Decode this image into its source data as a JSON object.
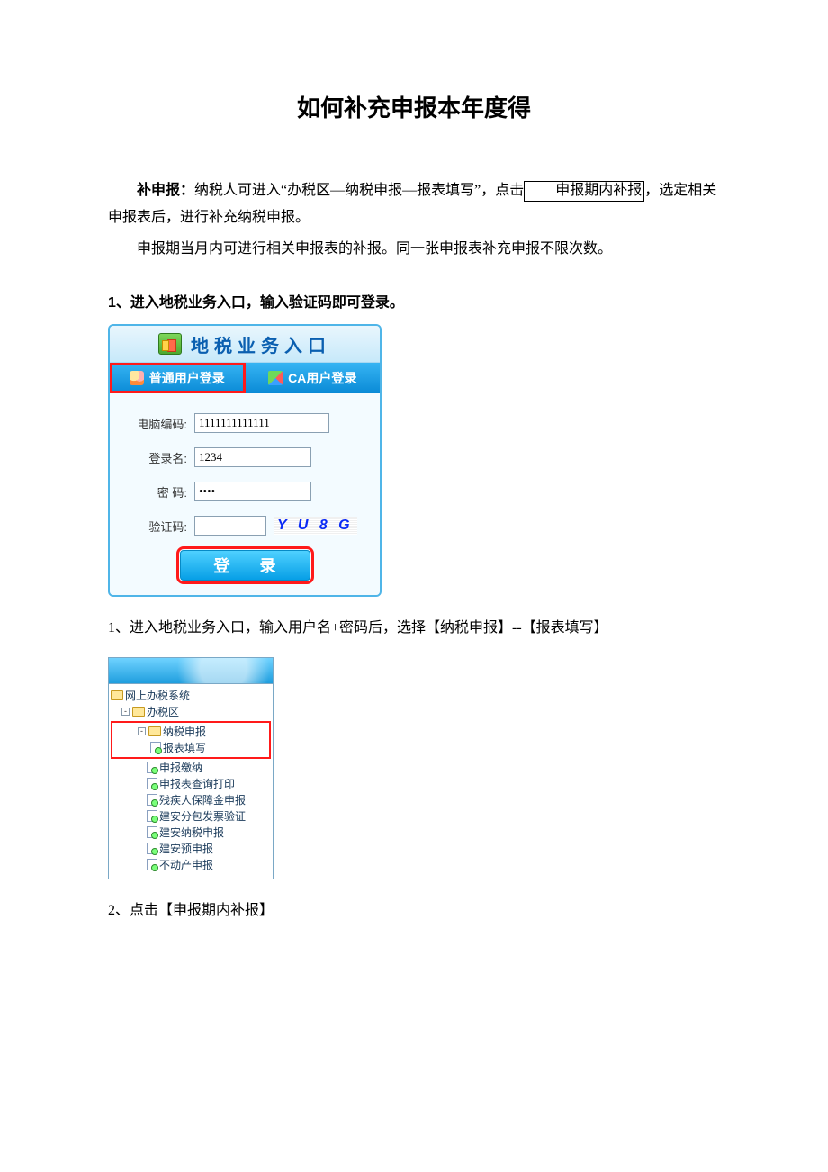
{
  "title": "如何补充申报本年度得",
  "para1_prefix_bold": "补申报：",
  "para1_text": "纳税人可进入“办税区—纳税申报—报表填写”，点击",
  "para1_boxed": "申报期内补报",
  "para1_tail": "，选定相关申报表后，进行补充纳税申报。",
  "para2": "申报期当月内可进行相关申报表的补报。同一张申报表补充申报不限次数。",
  "section1": "1、进入地税业务入口，输入验证码即可登录。",
  "login": {
    "header": "地税业务入口",
    "tab_normal": "普通用户登录",
    "tab_ca": "CA用户登录",
    "label_code": "电脑编码:",
    "label_user": "登录名:",
    "label_pass": "密  码:",
    "label_captcha": "验证码:",
    "value_code": "1111111111111",
    "value_user": "1234",
    "value_pass": "••••",
    "captcha": "Y U 8 G",
    "button": "登 录"
  },
  "caption1": "1、进入地税业务入口，输入用户名+密码后，选择【纳税申报】--【报表填写】",
  "tree": {
    "root": "网上办税系统",
    "n1": "办税区",
    "n2": "纳税申报",
    "children": [
      "报表填写",
      "申报缴纳",
      "申报表查询打印",
      "残疾人保障金申报",
      "建安分包发票验证",
      "建安纳税申报",
      "建安预申报",
      "不动产申报"
    ]
  },
  "caption2": "2、点击【申报期内补报】"
}
